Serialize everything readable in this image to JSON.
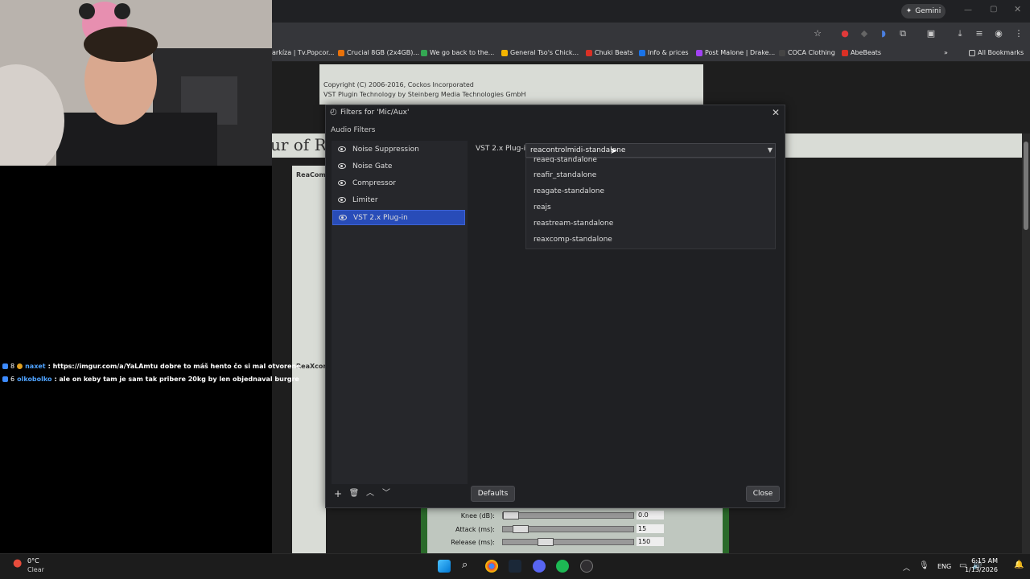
{
  "browser": {
    "gemini_label": "Gemini",
    "bookmarks": [
      {
        "label": "arkíza | Tv.Popcor...",
        "color": "#3a7bd5"
      },
      {
        "label": "Crucial 8GB (2x4GB)...",
        "color": "#e8710a"
      },
      {
        "label": "We go back to the...",
        "color": "#34a853"
      },
      {
        "label": "General Tso's Chick...",
        "color": "#f4b400"
      },
      {
        "label": "Chuki Beats",
        "color": "#d93025"
      },
      {
        "label": "Info & prices",
        "color": "#1a73e8"
      },
      {
        "label": "Post Malone | Drake...",
        "color": "#a142f4"
      },
      {
        "label": "COCA Clothing",
        "color": "#444444"
      },
      {
        "label": "AbeBeats",
        "color": "#d93025"
      }
    ],
    "all_bookmarks": "All Bookmarks"
  },
  "page": {
    "copyright_line1": "Copyright (C) 2006-2016, Cockos Incorporated",
    "copyright_line2": "VST Plugin Technology by Steinberg Media Technologies GmbH",
    "heading_fragment": "ur of Re",
    "section1": "ReaCom",
    "section2": "ReaXcor"
  },
  "plugin_panel": {
    "rows": [
      {
        "label": "Knee (dB):",
        "value": "0.0",
        "level": 0.0
      },
      {
        "label": "Attack (ms):",
        "value": "15",
        "level": 0.08
      },
      {
        "label": "Release (ms):",
        "value": "150",
        "level": 0.3
      }
    ]
  },
  "chat": [
    {
      "user": "naxet",
      "message": ": https://imgur.com/a/YaLAmtu dobre to máš hento čo si mal otvorene",
      "badge_count": "8"
    },
    {
      "user": "olkobolko",
      "message": ": ale on keby tam je sam tak pribere 20kg by len objednaval burgre",
      "badge_count": "6"
    }
  ],
  "dialog": {
    "title": "Filters for 'Mic/Aux'",
    "audio_filters_label": "Audio Filters",
    "filters": [
      {
        "label": "Noise Suppression",
        "selected": false
      },
      {
        "label": "Noise Gate",
        "selected": false
      },
      {
        "label": "Compressor",
        "selected": false
      },
      {
        "label": "Limiter",
        "selected": false
      },
      {
        "label": "VST 2.x Plug-in",
        "selected": true
      }
    ],
    "vst_label": "VST 2.x Plug-in",
    "combo_value": "reacontrolmidi-standalone",
    "dropdown_options": [
      "reaeq-standalone",
      "reafir_standalone",
      "reagate-standalone",
      "reajs",
      "reastream-standalone",
      "reaxcomp-standalone"
    ],
    "defaults_label": "Defaults",
    "close_label": "Close"
  },
  "taskbar": {
    "temperature": "0°C",
    "weather": "Clear",
    "language": "ENG",
    "time": "6:15 AM",
    "date": "1/13/2026"
  }
}
